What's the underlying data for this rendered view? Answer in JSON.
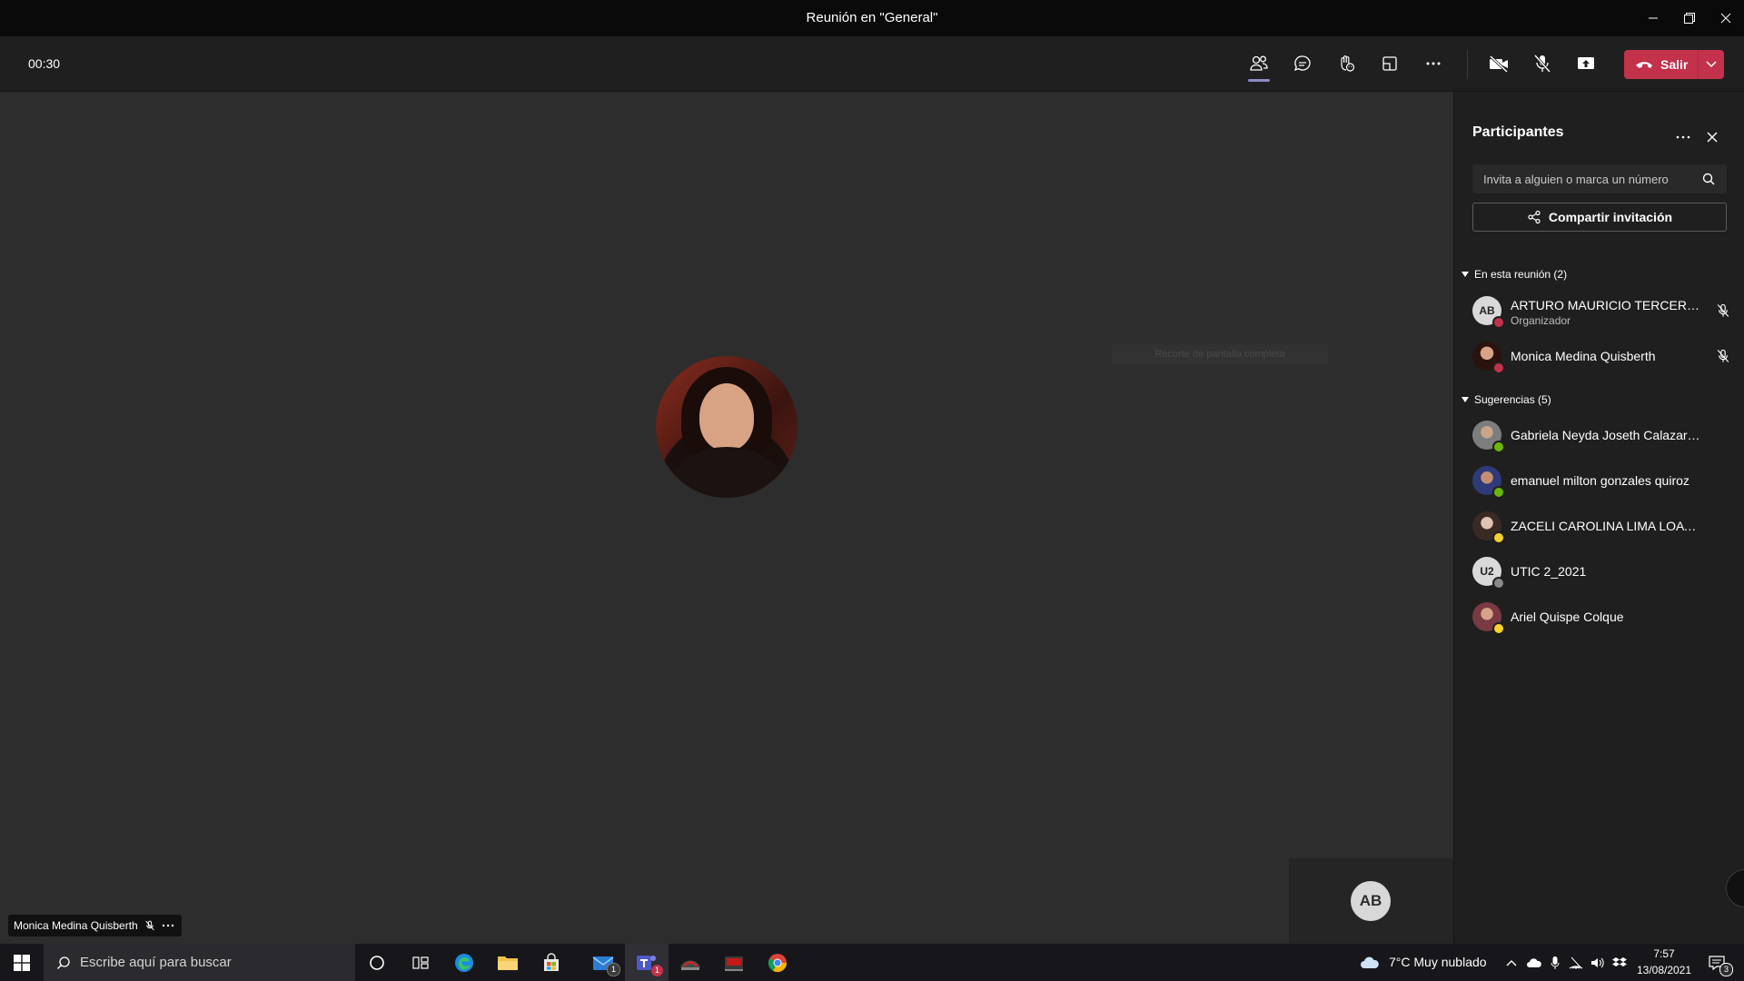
{
  "window": {
    "title": "Reunión en \"General\""
  },
  "toolbar": {
    "timer": "00:30",
    "leave_label": "Salir"
  },
  "stage": {
    "faint_tooltip": "Recorte de pantalla completa",
    "self_initials": "AB",
    "name_tag": "Monica Medina Quisberth"
  },
  "panel": {
    "title": "Participantes",
    "search_placeholder": "Invita a alguien o marca un número",
    "share_label": "Compartir invitación",
    "in_meeting_label": "En esta reunión (2)",
    "suggestions_label": "Sugerencias (5)",
    "in_meeting": [
      {
        "name": "ARTURO MAURICIO TERCEROS ...",
        "role": "Organizador",
        "initials": "AB"
      },
      {
        "name": "Monica Medina Quisberth"
      }
    ],
    "suggestions": [
      {
        "name": "Gabriela Neyda Joseth Calazar Callis..."
      },
      {
        "name": "emanuel milton gonzales quiroz"
      },
      {
        "name": "ZACELI CAROLINA LIMA LOAYZA"
      },
      {
        "name": "UTIC 2_2021",
        "initials": "U2"
      },
      {
        "name": "Ariel Quispe Colque"
      }
    ]
  },
  "taskbar": {
    "search_placeholder": "Escribe aquí para buscar",
    "mail_badge": "1",
    "teams_badge": "1",
    "weather": "7°C  Muy nublado",
    "time": "7:57",
    "date": "13/08/2021",
    "notifications_badge": "3"
  },
  "colors": {
    "accent": "#8b8cc7",
    "leave": "#c4314b",
    "stage_bg": "#2d2d2d",
    "panel_bg": "#1f1f1f"
  }
}
